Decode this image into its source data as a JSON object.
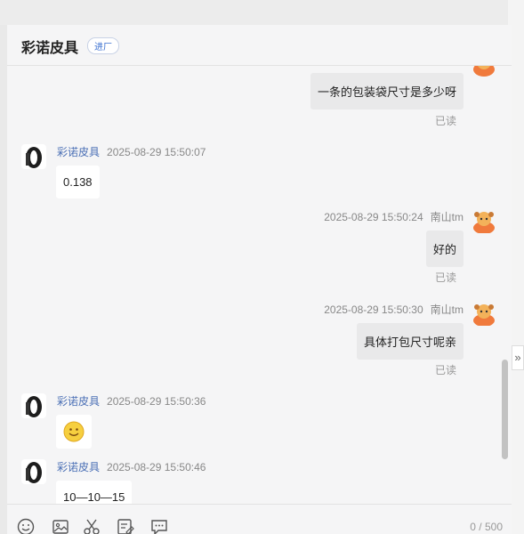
{
  "header": {
    "shop_name": "彩诺皮具",
    "badge": "进厂"
  },
  "messages": [
    {
      "text": "一条的包装袋尺寸是多少呀",
      "status": "已读"
    },
    {
      "sender": "彩诺皮具",
      "time": "2025-08-29 15:50:07",
      "text": "0.138"
    },
    {
      "sender": "南山tm",
      "time": "2025-08-29 15:50:24",
      "text": "好的",
      "status": "已读"
    },
    {
      "sender": "南山tm",
      "time": "2025-08-29 15:50:30",
      "text": "具体打包尺寸呢亲",
      "status": "已读"
    },
    {
      "sender": "彩诺皮具",
      "time": "2025-08-29 15:50:36",
      "emoji": "smile-emoji"
    },
    {
      "sender": "彩诺皮具",
      "time": "2025-08-29 15:50:46",
      "text": "10—10—15"
    }
  ],
  "input": {
    "counter": "0 / 500"
  },
  "toolbar": {
    "icons": [
      "emoji-icon",
      "image-icon",
      "scissors-icon",
      "edit-icon",
      "quick-reply-icon"
    ]
  },
  "sidetab": {
    "label": "»"
  }
}
